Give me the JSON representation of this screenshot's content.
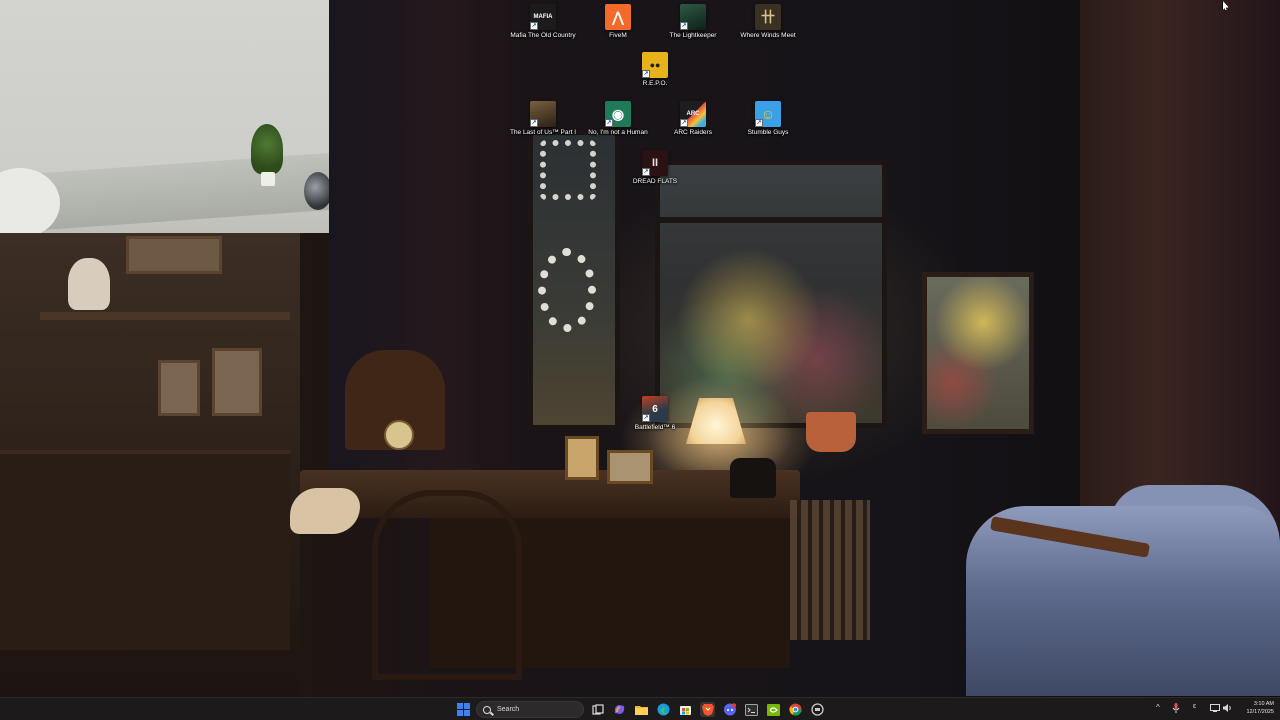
{
  "desktop": {
    "icons": [
      {
        "label": "Mafia The Old Country",
        "icon": "mafia-icon",
        "color": "#1b1b1b",
        "glyph": "MAFIA"
      },
      {
        "label": "FiveM",
        "icon": "fivem-icon",
        "color": "#f26b2a",
        "glyph": "⋀"
      },
      {
        "label": "The Lightkeeper",
        "icon": "lightkeeper-icon",
        "color": "#1e3a2c",
        "glyph": ""
      },
      {
        "label": "Where Winds Meet",
        "icon": "where-winds-meet-icon",
        "color": "#3a3122",
        "glyph": "卄"
      },
      {
        "label": "R.E.P.O.",
        "icon": "repo-icon",
        "color": "#e8b21a",
        "glyph": "●●"
      },
      {
        "label": "The Last of Us™ Part I",
        "icon": "last-of-us-icon",
        "color": "#4a3a28",
        "glyph": ""
      },
      {
        "label": "No, I'm not a Human",
        "icon": "not-a-human-icon",
        "color": "#1f7a5a",
        "glyph": "◉"
      },
      {
        "label": "ARC Raiders",
        "icon": "arc-raiders-icon",
        "color": "#1d1d1f",
        "glyph": "ARC"
      },
      {
        "label": "Stumble Guys",
        "icon": "stumble-guys-icon",
        "color": "#3aa0e8",
        "glyph": "☺"
      },
      {
        "label": "DREAD FLATS",
        "icon": "dread-flats-icon",
        "color": "#2a1212",
        "glyph": "II"
      },
      {
        "label": "Battlefield™ 6",
        "icon": "battlefield-icon",
        "color": "#2b3a4a",
        "glyph": "6"
      }
    ]
  },
  "taskbar": {
    "search_placeholder": "Search",
    "pinned": [
      {
        "icon": "start-icon",
        "color": "#3b82f6"
      },
      {
        "icon": "task-view-icon",
        "color": "#555555"
      },
      {
        "icon": "copilot-icon",
        "color": "#7a5cf0"
      },
      {
        "icon": "file-explorer-icon",
        "color": "#f0b429"
      },
      {
        "icon": "edge-icon",
        "color": "#1a9be0"
      },
      {
        "icon": "microsoft-store-icon",
        "color": "#3a3a3a"
      },
      {
        "icon": "brave-icon",
        "color": "#fb542b"
      },
      {
        "icon": "discord-icon",
        "color": "#5865f2"
      },
      {
        "icon": "terminal-icon",
        "color": "#2f2f2f"
      },
      {
        "icon": "nvidia-icon",
        "color": "#76b900"
      },
      {
        "icon": "chrome-icon",
        "color": "#db4437"
      },
      {
        "icon": "app-icon",
        "color": "#606060"
      }
    ],
    "tray": {
      "chevron": "^",
      "mic": "mic-icon",
      "language": "ε",
      "network": "network-icon",
      "volume": "volume-icon"
    },
    "clock": {
      "time": "3:10 AM",
      "date": "12/17/2025"
    }
  }
}
